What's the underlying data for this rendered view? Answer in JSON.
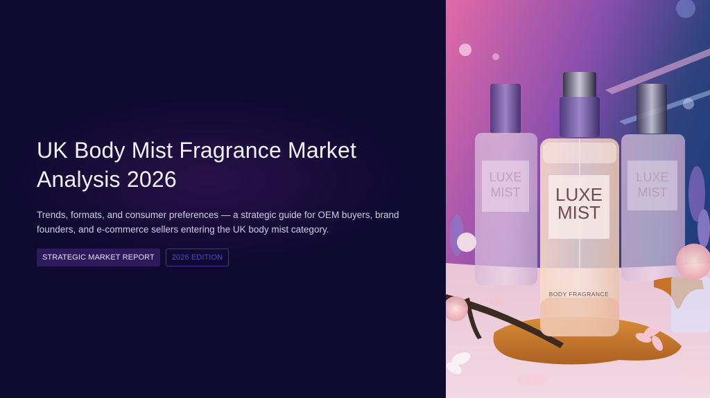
{
  "slide": {
    "title": "UK Body Mist Fragrance Market Analysis 2026",
    "subtitle": "Trends, formats, and consumer preferences — a strategic guide for OEM buyers, brand founders, and e-commerce sellers entering the UK body mist category.",
    "badges": {
      "primary": "STRATEGIC MARKET REPORT",
      "secondary": "2026 EDITION"
    }
  },
  "hero_image": {
    "bottle_label_line1": "LUXE",
    "bottle_label_line2": "MIST",
    "bottle_caption": "BODY FRAGRANCE",
    "side_label_line1": "LUXE",
    "side_label_line2": "MIST"
  },
  "colors": {
    "background": "#0e0a30",
    "title": "#f2f0fb",
    "badge_primary_bg": "#2c1a5c",
    "badge_outline": "#4a2fa3"
  }
}
